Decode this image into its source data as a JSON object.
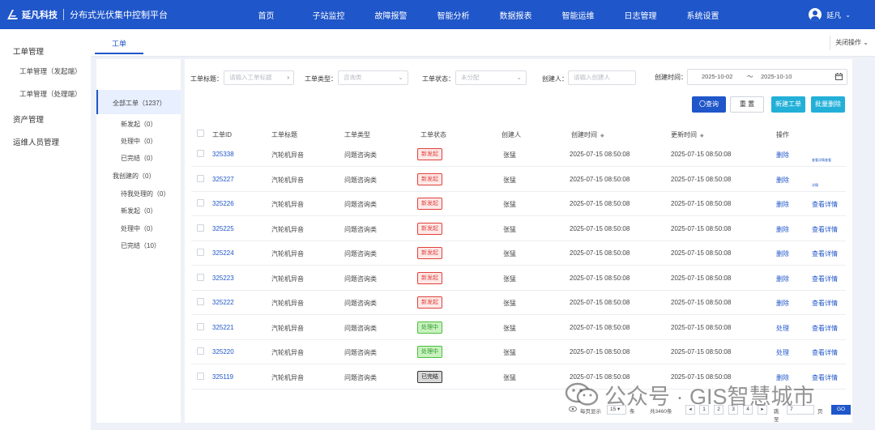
{
  "header": {
    "brand": "延凡科技",
    "app_title": "分布式光伏集中控制平台",
    "nav": [
      "首页",
      "子站监控",
      "故障报警",
      "智能分析",
      "数据报表",
      "智能运维",
      "日志管理",
      "系统设置"
    ],
    "user": "延凡",
    "brand_color": "#1f56c9"
  },
  "sidebar": {
    "groups": [
      {
        "label": "工单管理",
        "items": [
          "工单管理（发起端）",
          "工单管理（处理端）"
        ]
      },
      {
        "label": "资产管理",
        "items": []
      },
      {
        "label": "运维人员管理",
        "items": []
      }
    ]
  },
  "tabs": {
    "active": "工单",
    "close_ops": "关闭操作"
  },
  "filter_panel": {
    "all": "全部工单（1237）",
    "items": [
      "新发起（0）",
      "处理中（0）",
      "已完结（0）"
    ],
    "mine_label": "我创建的（0）",
    "mine_items": [
      "待我处理的（0）",
      "新发起（0）",
      "处理中（0）",
      "已完结（10）"
    ]
  },
  "filters": {
    "title_label": "工单标题：",
    "title_placeholder": "请输入工单标题",
    "type_label": "工单类型：",
    "type_placeholder": "咨询类",
    "status_label": "工单状态：",
    "status_placeholder": "未分配",
    "creator_label": "创建人：",
    "creator_placeholder": "请输入创建人",
    "time_label": "创建时间：",
    "date_from": "2025-10-02",
    "date_sep": "～",
    "date_to": "2025-10-10"
  },
  "buttons": {
    "query": "〇查询",
    "reset": "重 置",
    "new": "新建工单",
    "batch_delete": "批量删除"
  },
  "table": {
    "columns": [
      "工单ID",
      "工单标题",
      "工单类型",
      "工单状态",
      "创建人",
      "创建时间",
      "更新时间",
      "操作"
    ],
    "rows": [
      {
        "id": "325338",
        "title": "汽轮机异音",
        "type": "问题咨询类",
        "status": "新发起",
        "status_kind": "new",
        "creator": "张猛",
        "created": "2025-07-15 08:50:08",
        "updated": "2025-07-15 08:50:08",
        "action1": "删除",
        "action2": "查看详情查看"
      },
      {
        "id": "325227",
        "title": "汽轮机异音",
        "type": "问题咨询类",
        "status": "新发起",
        "status_kind": "new",
        "creator": "张猛",
        "created": "2025-07-15 08:50:08",
        "updated": "2025-07-15 08:50:08",
        "action1": "删除",
        "action2": "详情"
      },
      {
        "id": "325226",
        "title": "汽轮机异音",
        "type": "问题咨询类",
        "status": "新发起",
        "status_kind": "new",
        "creator": "张猛",
        "created": "2025-07-15 08:50:08",
        "updated": "2025-07-15 08:50:08",
        "action1": "删除",
        "action2": "查看详情"
      },
      {
        "id": "325225",
        "title": "汽轮机异音",
        "type": "问题咨询类",
        "status": "新发起",
        "status_kind": "new",
        "creator": "张猛",
        "created": "2025-07-15 08:50:08",
        "updated": "2025-07-15 08:50:08",
        "action1": "删除",
        "action2": "查看详情"
      },
      {
        "id": "325224",
        "title": "汽轮机异音",
        "type": "问题咨询类",
        "status": "新发起",
        "status_kind": "new",
        "creator": "张猛",
        "created": "2025-07-15 08:50:08",
        "updated": "2025-07-15 08:50:08",
        "action1": "删除",
        "action2": "查看详情"
      },
      {
        "id": "325223",
        "title": "汽轮机异音",
        "type": "问题咨询类",
        "status": "新发起",
        "status_kind": "new",
        "creator": "张猛",
        "created": "2025-07-15 08:50:08",
        "updated": "2025-07-15 08:50:08",
        "action1": "删除",
        "action2": "查看详情"
      },
      {
        "id": "325222",
        "title": "汽轮机异音",
        "type": "问题咨询类",
        "status": "新发起",
        "status_kind": "new",
        "creator": "张猛",
        "created": "2025-07-15 08:50:08",
        "updated": "2025-07-15 08:50:08",
        "action1": "删除",
        "action2": "查看详情"
      },
      {
        "id": "325221",
        "title": "汽轮机异音",
        "type": "问题咨询类",
        "status": "处理中",
        "status_kind": "proc",
        "creator": "张猛",
        "created": "2025-07-15 08:50:08",
        "updated": "2025-07-15 08:50:08",
        "action1": "处理",
        "action2": "查看详情"
      },
      {
        "id": "325220",
        "title": "汽轮机异音",
        "type": "问题咨询类",
        "status": "处理中",
        "status_kind": "proc",
        "creator": "张猛",
        "created": "2025-07-15 08:50:08",
        "updated": "2025-07-15 08:50:08",
        "action1": "处理",
        "action2": "查看详情"
      },
      {
        "id": "325119",
        "title": "汽轮机异音",
        "type": "问题咨询类",
        "status": "已完结",
        "status_kind": "done",
        "creator": "张猛",
        "created": "2025-07-15 08:50:08",
        "updated": "2025-07-15 08:50:08",
        "action1": "删除",
        "action2": "查看详情"
      }
    ]
  },
  "pagination": {
    "per_page_label": "每页显示",
    "per_page": "15",
    "per_page_unit": "条",
    "total": "共3460条",
    "pages": [
      "1",
      "2",
      "3",
      "4"
    ],
    "goto_label": "跳至",
    "goto_value": "7",
    "goto_unit": "页",
    "go": "GO"
  },
  "watermark": "公众号 · GIS智慧城市",
  "colors": {
    "primary": "#1f56c9",
    "cyan": "#22b0d8",
    "danger": "#e0413b",
    "success": "#4cbf3e"
  }
}
